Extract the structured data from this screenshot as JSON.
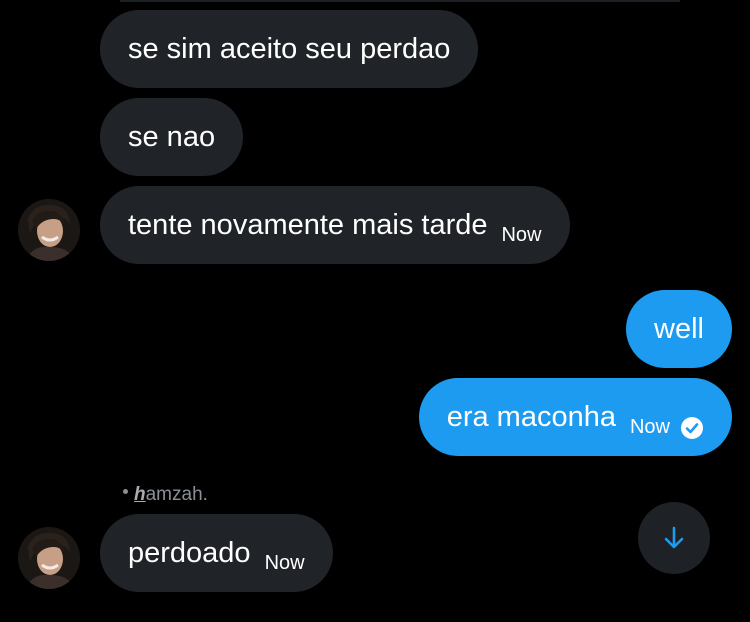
{
  "colors": {
    "background": "#000000",
    "incoming_bubble": "#202327",
    "outgoing_bubble": "#1d9bf0",
    "accent": "#1d9bf0",
    "muted_text": "#8b9096"
  },
  "messages": [
    {
      "direction": "incoming",
      "text": "se sim aceito seu perdao"
    },
    {
      "direction": "incoming",
      "text": "se nao"
    },
    {
      "direction": "incoming",
      "text": "tente novamente mais tarde",
      "time": "Now"
    },
    {
      "direction": "outgoing",
      "text": "well"
    },
    {
      "direction": "outgoing",
      "text": "era maconha",
      "time": "Now",
      "status_icon": "read-check-icon"
    },
    {
      "direction": "incoming",
      "text": "perdoado",
      "time": "Now"
    }
  ],
  "reply_label": {
    "icon": "dot-icon",
    "logo_letter": "h",
    "name_rest": "amzah."
  },
  "scroll_button": {
    "icon": "arrow-down-icon"
  }
}
